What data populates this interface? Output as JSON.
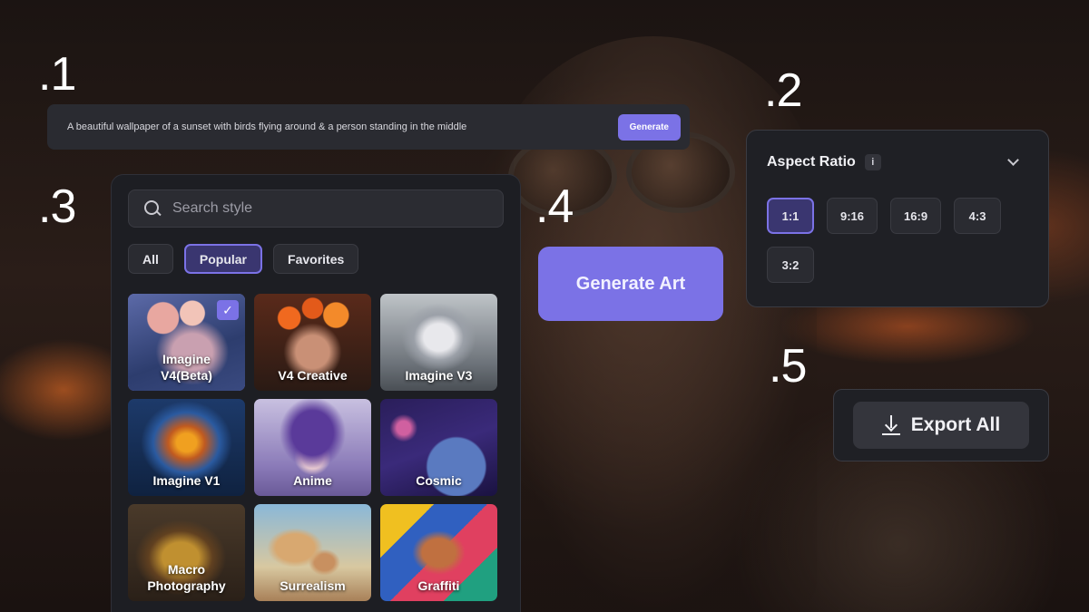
{
  "steps": [
    ".1",
    ".2",
    ".3",
    ".4",
    ".5"
  ],
  "prompt": {
    "text": "A beautiful wallpaper of a sunset with birds flying around & a person standing in the middle",
    "button_label": "Generate"
  },
  "style_panel": {
    "search_placeholder": "Search style",
    "filters": [
      "All",
      "Popular",
      "Favorites"
    ],
    "active_filter": "Popular",
    "styles": [
      {
        "label": "Imagine V4(Beta)",
        "selected": true
      },
      {
        "label": "V4 Creative",
        "selected": false
      },
      {
        "label": "Imagine V3",
        "selected": false
      },
      {
        "label": "Imagine V1",
        "selected": false
      },
      {
        "label": "Anime",
        "selected": false
      },
      {
        "label": "Cosmic",
        "selected": false
      },
      {
        "label": "Macro Photography",
        "selected": false
      },
      {
        "label": "Surrealism",
        "selected": false
      },
      {
        "label": "Graffiti",
        "selected": false
      }
    ]
  },
  "generate_art": {
    "label": "Generate Art"
  },
  "aspect_ratio": {
    "title": "Aspect Ratio",
    "info": "i",
    "options": [
      "1:1",
      "9:16",
      "16:9",
      "4:3",
      "3:2"
    ],
    "selected": "1:1"
  },
  "export": {
    "label": "Export All"
  },
  "colors": {
    "accent": "#7b72e6",
    "panel": "#1d1e23",
    "chip": "#2a2b31"
  }
}
